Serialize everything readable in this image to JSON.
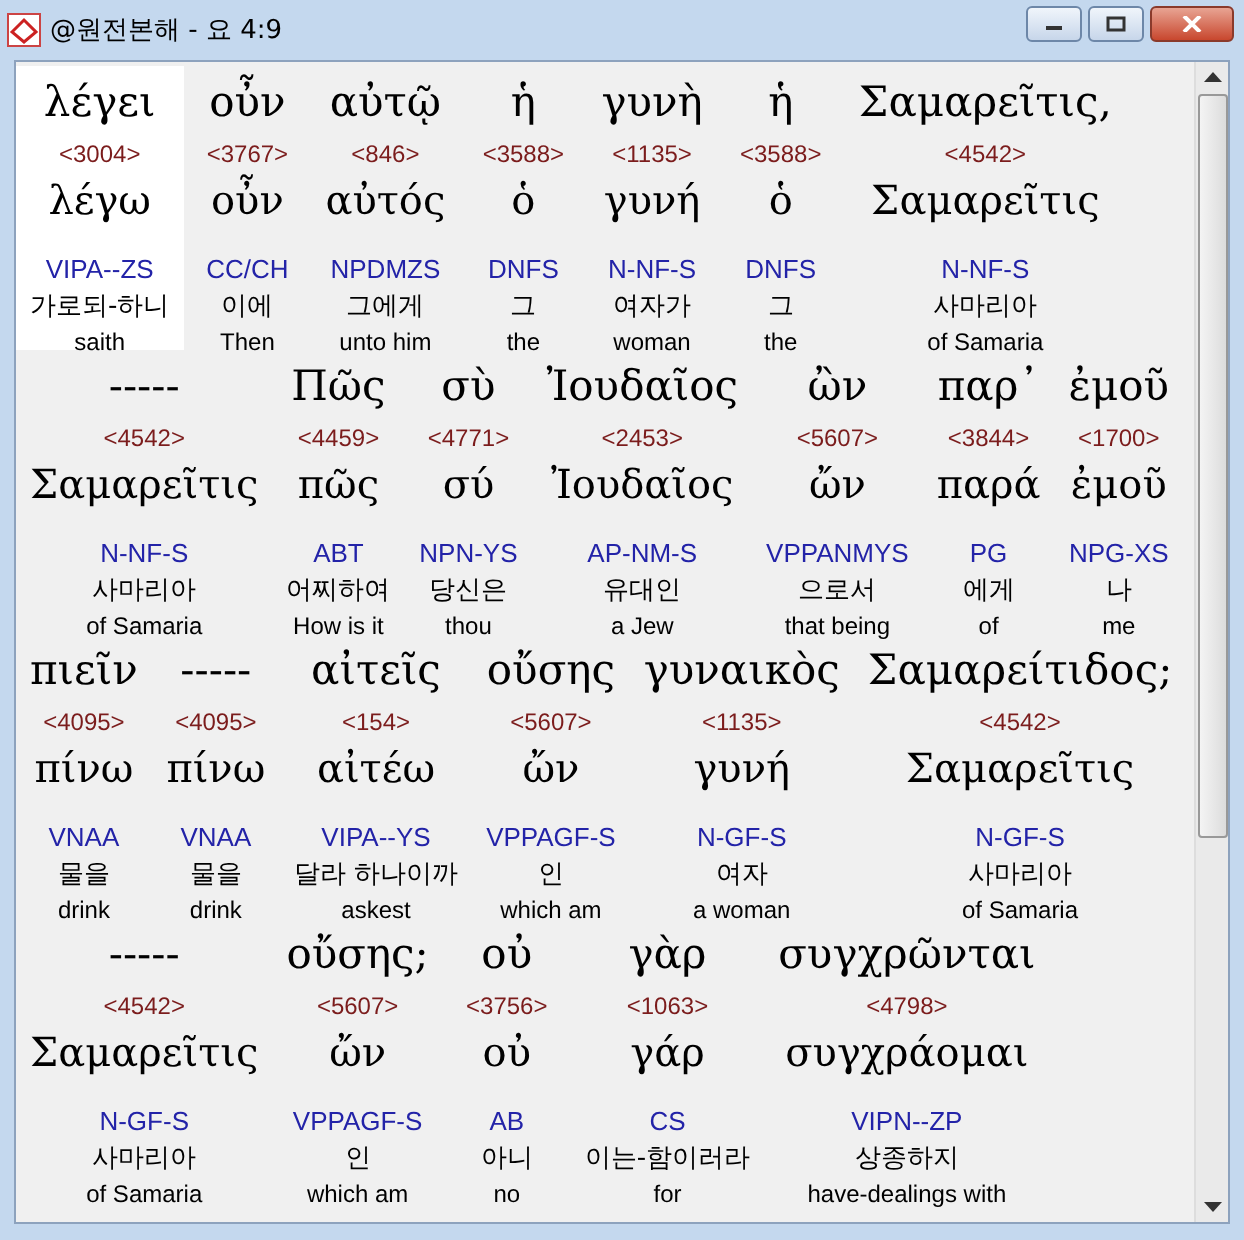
{
  "window": {
    "title": "@원전본해 - 요 4:9"
  },
  "lines": [
    {
      "words": [
        {
          "greek": "λέγει",
          "strong": "<3004>",
          "lemma": "λέγω",
          "parse": "VIPA--ZS",
          "korean": "가로되-하니",
          "english": "saith",
          "selected": true
        },
        {
          "greek": "οὖν",
          "strong": "<3767>",
          "lemma": "οὖν",
          "parse": "CC/CH",
          "korean": "이에",
          "english": "Then",
          "selected": false
        },
        {
          "greek": "αὐτῷ",
          "strong": "<846>",
          "lemma": "αὐτός",
          "parse": "NPDMZS",
          "korean": "그에게",
          "english": "unto him",
          "selected": false
        },
        {
          "greek": "ἡ",
          "strong": "<3588>",
          "lemma": "ὁ",
          "parse": "DNFS",
          "korean": "그",
          "english": "the",
          "selected": false
        },
        {
          "greek": "γυνὴ",
          "strong": "<1135>",
          "lemma": "γυνή",
          "parse": "N-NF-S",
          "korean": "여자가",
          "english": "woman",
          "selected": false
        },
        {
          "greek": "ἡ",
          "strong": "<3588>",
          "lemma": "ὁ",
          "parse": "DNFS",
          "korean": "그",
          "english": "the",
          "selected": false
        },
        {
          "greek": "Σαμαρεῖτις,",
          "strong": "<4542>",
          "lemma": "Σαμαρεῖτις",
          "parse": "N-NF-S",
          "korean": "사마리아",
          "english": "of Samaria",
          "selected": false
        }
      ]
    },
    {
      "words": [
        {
          "greek": "-----",
          "strong": "<4542>",
          "lemma": "Σαμαρεῖτις",
          "parse": "N-NF-S",
          "korean": "사마리아",
          "english": "of Samaria",
          "selected": false
        },
        {
          "greek": "Πῶς",
          "strong": "<4459>",
          "lemma": "πῶς",
          "parse": "ABT",
          "korean": "어찌하여",
          "english": "How is it",
          "selected": false
        },
        {
          "greek": "σὺ",
          "strong": "<4771>",
          "lemma": "σύ",
          "parse": "NPN-YS",
          "korean": "당신은",
          "english": "thou",
          "selected": false
        },
        {
          "greek": "Ἰουδαῖος",
          "strong": "<2453>",
          "lemma": "Ἰουδαῖος",
          "parse": "AP-NM-S",
          "korean": "유대인",
          "english": "a Jew",
          "selected": false
        },
        {
          "greek": "ὢν",
          "strong": "<5607>",
          "lemma": "ὤν",
          "parse": "VPPANMYS",
          "korean": "으로서",
          "english": "that being",
          "selected": false
        },
        {
          "greek": "παρ᾽",
          "strong": "<3844>",
          "lemma": "παρά",
          "parse": "PG",
          "korean": "에게",
          "english": "of",
          "selected": false
        },
        {
          "greek": "ἐμοῦ",
          "strong": "<1700>",
          "lemma": "ἐμοῦ",
          "parse": "NPG-XS",
          "korean": "나",
          "english": "me",
          "selected": false
        }
      ]
    },
    {
      "words": [
        {
          "greek": "πιεῖν",
          "strong": "<4095>",
          "lemma": "πίνω",
          "parse": "VNAA",
          "korean": "물을",
          "english": "drink",
          "selected": false
        },
        {
          "greek": "-----",
          "strong": "<4095>",
          "lemma": "πίνω",
          "parse": "VNAA",
          "korean": "물을",
          "english": "drink",
          "selected": false
        },
        {
          "greek": "αἰτεῖς",
          "strong": "<154>",
          "lemma": "αἰτέω",
          "parse": "VIPA--YS",
          "korean": "달라 하나이까",
          "english": "askest",
          "selected": false
        },
        {
          "greek": "οὔσης",
          "strong": "<5607>",
          "lemma": "ὤν",
          "parse": "VPPAGF-S",
          "korean": "인",
          "english": "which am",
          "selected": false
        },
        {
          "greek": "γυναικὸς",
          "strong": "<1135>",
          "lemma": "γυνή",
          "parse": "N-GF-S",
          "korean": "여자",
          "english": "a woman",
          "selected": false
        },
        {
          "greek": "Σαμαρείτιδος;",
          "strong": "<4542>",
          "lemma": "Σαμαρεῖτις",
          "parse": "N-GF-S",
          "korean": "사마리아",
          "english": "of Samaria",
          "selected": false
        }
      ]
    },
    {
      "words": [
        {
          "greek": "-----",
          "strong": "<4542>",
          "lemma": "Σαμαρεῖτις",
          "parse": "N-GF-S",
          "korean": "사마리아",
          "english": "of Samaria",
          "selected": false
        },
        {
          "greek": "οὔσης;",
          "strong": "<5607>",
          "lemma": "ὤν",
          "parse": "VPPAGF-S",
          "korean": "인",
          "english": "which am",
          "selected": false
        },
        {
          "greek": "οὐ",
          "strong": "<3756>",
          "lemma": "οὐ",
          "parse": "AB",
          "korean": "아니",
          "english": "no",
          "selected": false
        },
        {
          "greek": "γὰρ",
          "strong": "<1063>",
          "lemma": "γάρ",
          "parse": "CS",
          "korean": "이는-함이러라",
          "english": "for",
          "selected": false
        },
        {
          "greek": "συγχρῶνται",
          "strong": "<4798>",
          "lemma": "συγχράομαι",
          "parse": "VIPN--ZP",
          "korean": "상종하지",
          "english": "have-dealings with",
          "selected": false
        }
      ]
    }
  ]
}
